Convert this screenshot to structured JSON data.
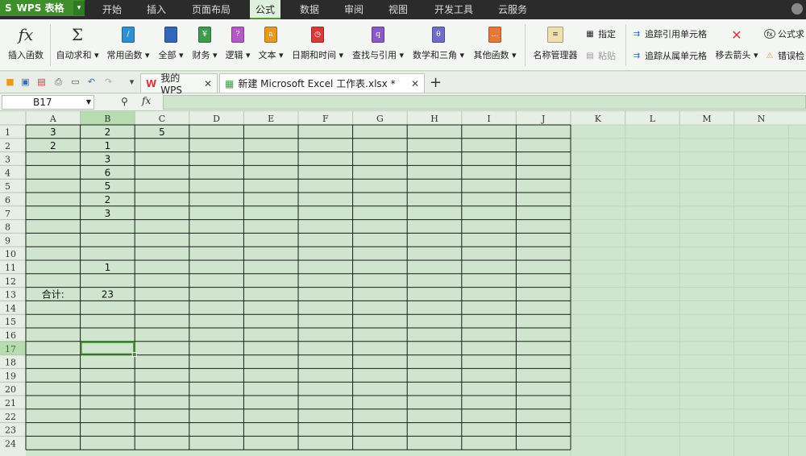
{
  "app": {
    "title": "WPS 表格",
    "logo_letter": "S"
  },
  "menu": [
    "开始",
    "插入",
    "页面布局",
    "公式",
    "数据",
    "审阅",
    "视图",
    "开发工具",
    "云服务"
  ],
  "menu_active": "公式",
  "ribbon": {
    "insert_function": "插入函数",
    "autosum": "自动求和",
    "common": "常用函数",
    "all": "全部",
    "finance": "财务",
    "logic": "逻辑",
    "text": "文本",
    "datetime": "日期和时间",
    "lookup": "查找与引用",
    "math": "数学和三角",
    "other": "其他函数",
    "name_manager": "名称管理器",
    "specify": "指定",
    "paste": "粘贴",
    "trace_precedents": "追踪引用单元格",
    "trace_dependents": "追踪从属单元格",
    "remove_arrows": "移去箭头",
    "formula_eval": "公式求",
    "error_check": "错误检"
  },
  "tabs": {
    "mywps": "我的WPS",
    "file": "新建 Microsoft Excel 工作表.xlsx *"
  },
  "namebox": "B17",
  "fx": "fx",
  "columns": [
    "A",
    "B",
    "C",
    "D",
    "E",
    "F",
    "G",
    "H",
    "I",
    "J",
    "K",
    "L",
    "M",
    "N"
  ],
  "rows": [
    "1",
    "2",
    "3",
    "4",
    "5",
    "6",
    "7",
    "8",
    "9",
    "10",
    "11",
    "12",
    "13",
    "14",
    "15",
    "16",
    "17",
    "18",
    "19",
    "20",
    "21",
    "22",
    "23",
    "24"
  ],
  "cells": [
    {
      "ref": "A1",
      "value": "3"
    },
    {
      "ref": "B1",
      "value": "2"
    },
    {
      "ref": "C1",
      "value": "5"
    },
    {
      "ref": "A2",
      "value": "2"
    },
    {
      "ref": "B2",
      "value": "1"
    },
    {
      "ref": "B3",
      "value": "3"
    },
    {
      "ref": "B4",
      "value": "6"
    },
    {
      "ref": "B5",
      "value": "5"
    },
    {
      "ref": "B6",
      "value": "2"
    },
    {
      "ref": "B7",
      "value": "3"
    },
    {
      "ref": "B11",
      "value": "1"
    },
    {
      "ref": "A13",
      "value": "合计:"
    },
    {
      "ref": "B13",
      "value": "23"
    }
  ],
  "selected": "B17",
  "colors": {
    "sheet_bg": "#cfe5cd",
    "header_bg": "#e6efe4",
    "selected_header": "#b9dbb1",
    "selection": "#3d8a2f",
    "menubar": "#2b2b2b",
    "brand": "#3f8e2c"
  }
}
